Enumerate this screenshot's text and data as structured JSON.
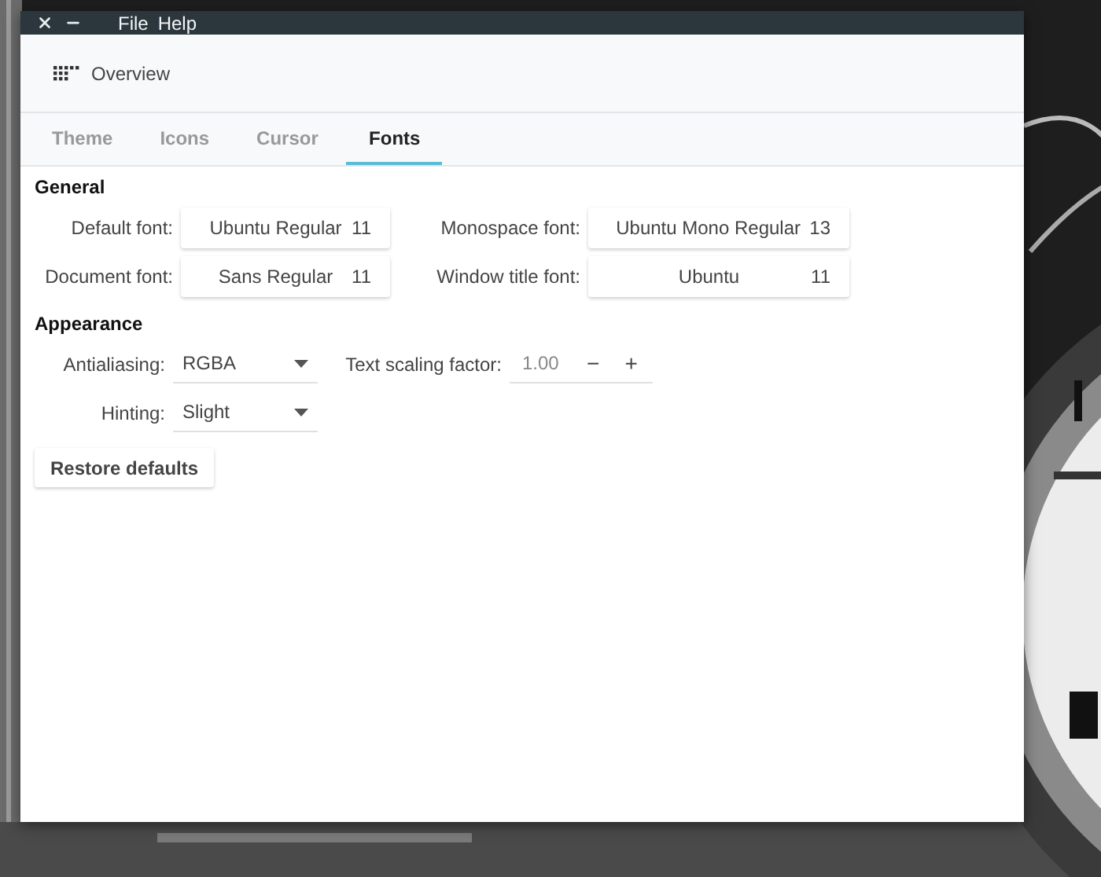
{
  "window": {
    "menu": [
      "File",
      "Help"
    ]
  },
  "header": {
    "title": "Overview"
  },
  "tabs": [
    {
      "label": "Theme",
      "selected": false
    },
    {
      "label": "Icons",
      "selected": false
    },
    {
      "label": "Cursor",
      "selected": false
    },
    {
      "label": "Fonts",
      "selected": true
    }
  ],
  "general": {
    "title": "General",
    "fonts": [
      {
        "label": "Default font:",
        "value": "Ubuntu Regular",
        "size": "11"
      },
      {
        "label": "Monospace font:",
        "value": "Ubuntu Mono Regular",
        "size": "13"
      },
      {
        "label": "Document font:",
        "value": "Sans Regular",
        "size": "11"
      },
      {
        "label": "Window title font:",
        "value": "Ubuntu",
        "size": "11"
      }
    ]
  },
  "appearance": {
    "title": "Appearance",
    "antialiasing": {
      "label": "Antialiasing:",
      "value": "RGBA"
    },
    "scaling": {
      "label": "Text scaling factor:",
      "value": "1.00",
      "minus": "−",
      "plus": "+"
    },
    "hinting": {
      "label": "Hinting:",
      "value": "Slight"
    }
  },
  "restore_button": "Restore defaults"
}
